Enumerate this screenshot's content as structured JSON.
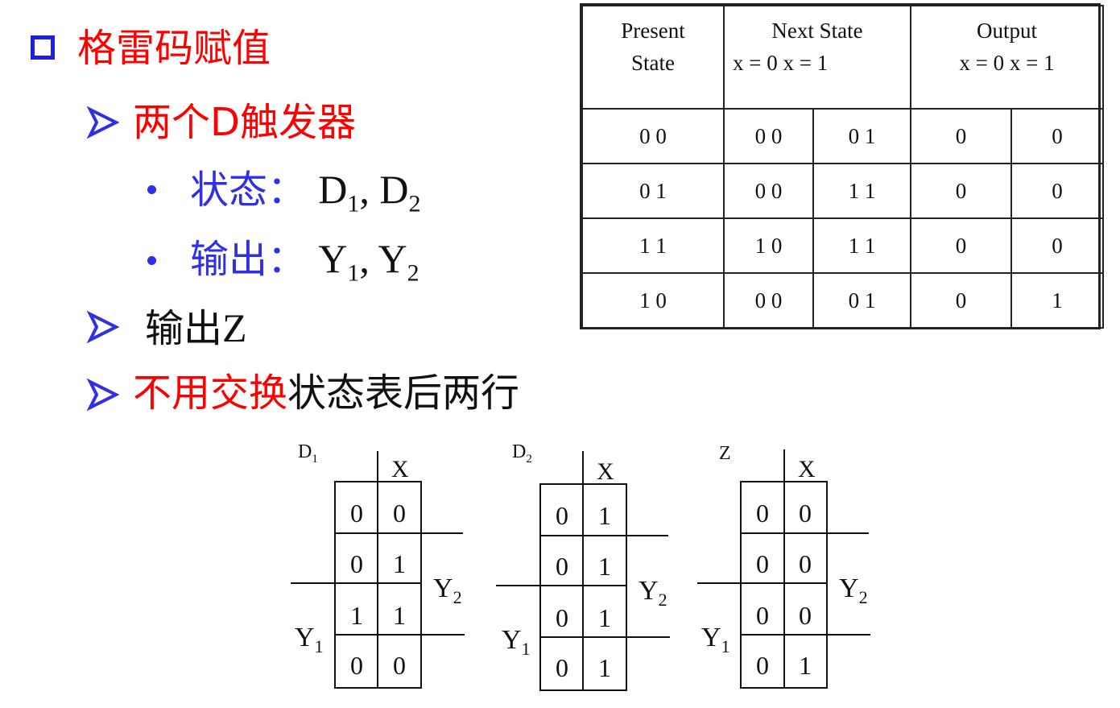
{
  "slide": {
    "heading": "格雷码赋值",
    "item1": "两个D触发器",
    "sub1_label": "状态：",
    "sub1_vars": [
      "D",
      "1",
      "D",
      "2"
    ],
    "sub2_label": "输出：",
    "sub2_vars": [
      "Y",
      "1",
      "Y",
      "2"
    ],
    "item2_cn": "输出",
    "item2_var": "Z",
    "item3_red": "不用交换",
    "item3_black": "状态表后两行",
    "comma": ","
  },
  "table": {
    "header_present": [
      "Present",
      "State"
    ],
    "header_next": "Next State",
    "header_next_sub": "x = 0 x = 1",
    "header_output": "Output",
    "header_output_sub": "x = 0 x = 1",
    "rows": [
      [
        "0 0",
        "0 0",
        "0 1",
        "0",
        "0"
      ],
      [
        "0 1",
        "0 0",
        "1 1",
        "0",
        "0"
      ],
      [
        "1 1",
        "1 0",
        "1 1",
        "0",
        "0"
      ],
      [
        "1 0",
        "0 0",
        "0 1",
        "0",
        "1"
      ]
    ]
  },
  "kmaps": [
    {
      "title": "D",
      "title_sub": "1",
      "x_label": "X",
      "y1": "Y",
      "y1_sub": "1",
      "y2": "Y",
      "y2_sub": "2",
      "cells": [
        [
          "0",
          "0"
        ],
        [
          "0",
          "1"
        ],
        [
          "1",
          "1"
        ],
        [
          "0",
          "0"
        ]
      ]
    },
    {
      "title": "D",
      "title_sub": "2",
      "x_label": "X",
      "y1": "Y",
      "y1_sub": "1",
      "y2": "Y",
      "y2_sub": "2",
      "cells": [
        [
          "0",
          "1"
        ],
        [
          "0",
          "1"
        ],
        [
          "0",
          "1"
        ],
        [
          "0",
          "1"
        ]
      ]
    },
    {
      "title": "Z",
      "title_sub": "",
      "x_label": "X",
      "y1": "Y",
      "y1_sub": "1",
      "y2": "Y",
      "y2_sub": "2",
      "cells": [
        [
          "0",
          "0"
        ],
        [
          "0",
          "0"
        ],
        [
          "0",
          "0"
        ],
        [
          "0",
          "1"
        ]
      ]
    }
  ],
  "colors": {
    "red": "#ff0000",
    "blue": "#2f2fe6",
    "black": "#111111"
  }
}
